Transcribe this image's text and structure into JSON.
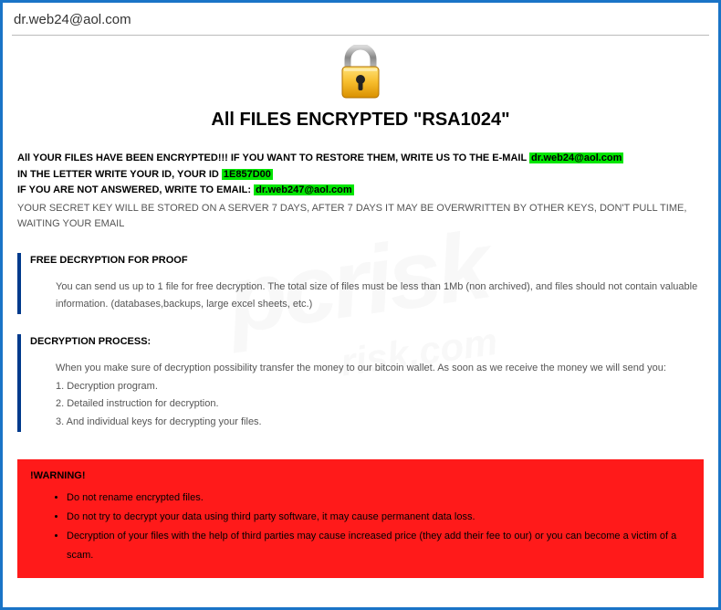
{
  "titlebar": {
    "text": "dr.web24@aol.com"
  },
  "headline": "All FILES ENCRYPTED \"RSA1024\"",
  "intro": {
    "line1_prefix": "All YOUR FILES HAVE BEEN ENCRYPTED!!! IF YOU WANT TO RESTORE THEM, WRITE US TO THE E-MAIL ",
    "email1": "dr.web24@aol.com",
    "line2_prefix": "IN THE LETTER WRITE YOUR ID, YOUR ID ",
    "id": "1E857D00",
    "line3_prefix": "IF YOU ARE NOT ANSWERED, WRITE TO EMAIL: ",
    "email2": "dr.web247@aol.com",
    "line4": "YOUR SECRET KEY WILL BE STORED ON A SERVER 7 DAYS, AFTER 7 DAYS IT MAY BE OVERWRITTEN BY OTHER KEYS, DON'T PULL TIME, WAITING YOUR EMAIL"
  },
  "block1": {
    "title": "FREE DECRYPTION FOR PROOF",
    "text": "You can send us up to 1 file for free decryption. The total size of files must be less than 1Mb (non archived), and files should not contain valuable information. (databases,backups, large excel sheets, etc.)"
  },
  "block2": {
    "title": "DECRYPTION PROCESS:",
    "line0": "When you make sure of decryption possibility transfer the money to our bitcoin wallet. As soon as we receive the money we will send you:",
    "line1": "1. Decryption program.",
    "line2": "2. Detailed instruction for decryption.",
    "line3": "3. And individual keys for decrypting your files."
  },
  "warning": {
    "title": "!WARNING!",
    "items": [
      "Do not rename encrypted files.",
      "Do not try to decrypt your data using third party software, it may cause permanent data loss.",
      "Decryption of your files with the help of third parties may cause increased price (they add their fee to our) or you can become a victim of a scam."
    ]
  },
  "watermark": {
    "main": "pcrisk",
    "sub": "risk.com"
  }
}
